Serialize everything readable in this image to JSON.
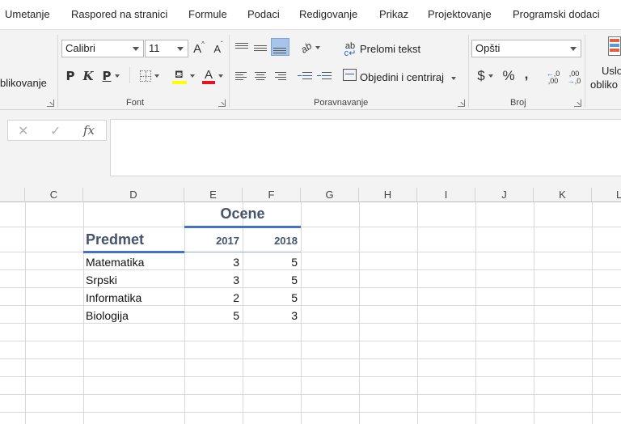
{
  "tabs": [
    "Umetanje",
    "Raspored na stranici",
    "Formule",
    "Podaci",
    "Redigovanje",
    "Prikaz",
    "Projektovanje",
    "Programski dodaci"
  ],
  "ribbon": {
    "styles_partial_label": "blikovanje",
    "font": {
      "group_label": "Font",
      "font_name": "Calibri",
      "font_size": "11",
      "grow": "A",
      "shrink": "A",
      "bold": "P",
      "italic": "K",
      "underline": "P"
    },
    "alignment": {
      "group_label": "Poravnavanje",
      "wrap_text": "Prelomi tekst",
      "merge_center": "Objedini i centriraj"
    },
    "number": {
      "group_label": "Broj",
      "format": "Opšti",
      "currency": "$",
      "percent": "%",
      "comma": ","
    },
    "conditional_partial": [
      "Uslo",
      "obliko"
    ]
  },
  "formula_bar": {
    "cancel": "✕",
    "enter": "✓",
    "fx": "fx",
    "value": ""
  },
  "columns": [
    "C",
    "D",
    "E",
    "F",
    "G",
    "H",
    "I",
    "J",
    "K",
    "L"
  ],
  "sheet": {
    "title": "Ocene",
    "subject_header": "Predmet",
    "years": [
      "2017",
      "2018"
    ],
    "rows": [
      {
        "subject": "Matematika",
        "y2017": "3",
        "y2018": "5"
      },
      {
        "subject": "Srpski",
        "y2017": "3",
        "y2018": "5"
      },
      {
        "subject": "Informatika",
        "y2017": "2",
        "y2018": "5"
      },
      {
        "subject": "Biologija",
        "y2017": "5",
        "y2018": "3"
      }
    ]
  },
  "colors": {
    "accent_blue": "#4472c4",
    "header_text": "#44546a",
    "highlight_yellow": "#ffff00",
    "font_red": "#e81123"
  }
}
